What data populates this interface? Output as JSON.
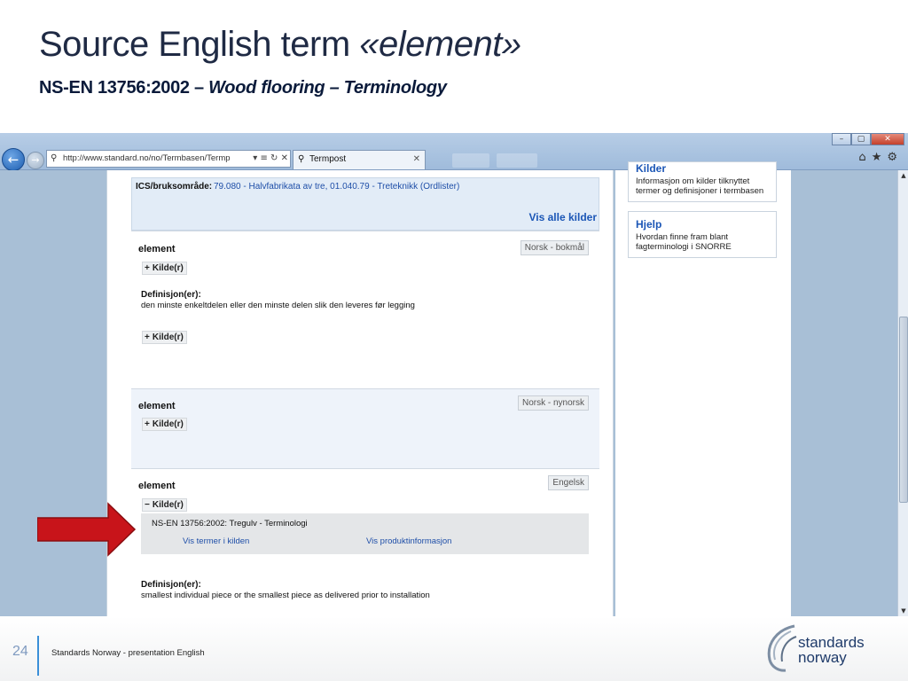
{
  "slide": {
    "title_prefix": "Source English term ",
    "title_term": "«element»",
    "subtitle_prefix": "NS-EN 13756:2002 – ",
    "subtitle_italic": "Wood flooring – Terminology"
  },
  "browser": {
    "address_url": "http://www.standard.no/no/Termbasen/Termp",
    "address_tools": "▾ ≡ ↻ ✕",
    "tab_title": "Termpost",
    "window_buttons": [
      "–",
      "▢",
      "✕"
    ],
    "toolbar_icons": [
      "home-icon",
      "star-icon",
      "gear-icon"
    ]
  },
  "page": {
    "ics_label": "ICS/bruksområde:",
    "ics_value": "79.080 - Halvfabrikata av tre, 01.040.79 - Treteknikk (Ordlister)",
    "show_all_sources": "Vis alle kilder",
    "entries": [
      {
        "term": "element",
        "language": "Norsk - bokmål",
        "source_toggle_1": "Kilde(r)",
        "definition_label": "Definisjon(er):",
        "definition": "den minste enkeltdelen eller den minste delen slik den leveres før legging",
        "source_toggle_2": "Kilde(r)"
      },
      {
        "term": "element",
        "language": "Norsk - nynorsk",
        "source_toggle": "Kilde(r)"
      },
      {
        "term": "element",
        "language": "Engelsk",
        "source_toggle": "Kilde(r)",
        "source_name": "NS-EN 13756:2002: Tregulv - Terminologi",
        "link_terms": "Vis termer i kilden",
        "link_product": "Vis produktinformasjon",
        "definition_label": "Definisjon(er):",
        "definition": "smallest individual piece or the smallest piece as delivered prior to installation"
      }
    ]
  },
  "sidebar": {
    "kilder_heading": "Kilder",
    "kilder_text": "Informasjon om kilder tilknyttet termer og definisjoner i termbasen",
    "hjelp_heading": "Hjelp",
    "hjelp_text": "Hvordan finne fram blant fagterminologi i SNORRE"
  },
  "footer": {
    "page_number": "24",
    "text": "Standards Norway - presentation English",
    "logo_line1": "standards",
    "logo_line2": "norway"
  },
  "colors": {
    "arrow": "#c8141a",
    "link": "#1f4fa8",
    "accent_rule": "#3a8fd8"
  }
}
